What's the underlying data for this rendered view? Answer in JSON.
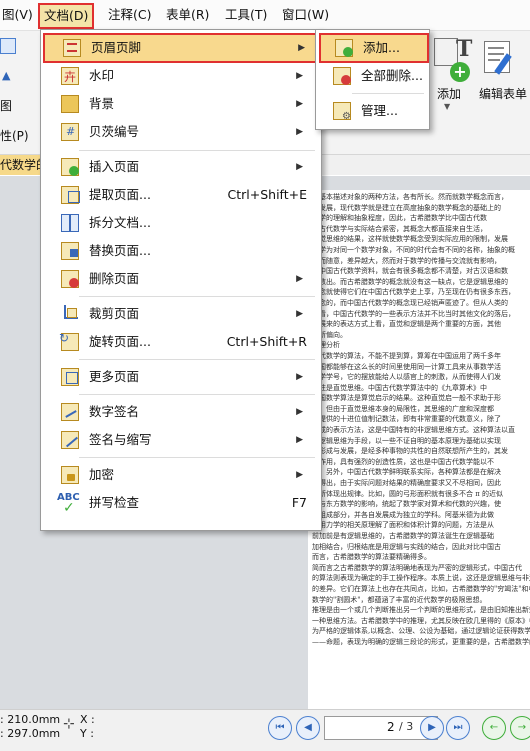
{
  "menubar": {
    "items": [
      {
        "label": "图(V)"
      },
      {
        "label": "文档(D)"
      },
      {
        "label": "注释(C)"
      },
      {
        "label": "表单(R)"
      },
      {
        "label": "工具(T)"
      },
      {
        "label": "窗口(W)"
      }
    ]
  },
  "toolbar": {
    "left_labels": [
      "图",
      "性(P)"
    ],
    "add_label": "添加",
    "edit_form_label": "编辑表单"
  },
  "doc_tab": {
    "label": "代数学的"
  },
  "document_menu": {
    "items": [
      {
        "label": "页眉页脚",
        "shortcut": "",
        "icon": "header-footer-icon"
      },
      {
        "label": "水印",
        "shortcut": "",
        "icon": "watermark-icon"
      },
      {
        "label": "背景",
        "shortcut": "",
        "icon": "background-icon"
      },
      {
        "label": "贝茨编号",
        "shortcut": "",
        "icon": "bates-numbering-icon"
      },
      {
        "label": "插入页面",
        "shortcut": "",
        "icon": "insert-page-icon"
      },
      {
        "label": "提取页面...",
        "shortcut": "Ctrl+Shift+E",
        "icon": "extract-page-icon"
      },
      {
        "label": "拆分文档...",
        "shortcut": "",
        "icon": "split-document-icon"
      },
      {
        "label": "替换页面...",
        "shortcut": "",
        "icon": "replace-page-icon"
      },
      {
        "label": "删除页面",
        "shortcut": "",
        "icon": "delete-page-icon"
      },
      {
        "label": "裁剪页面",
        "shortcut": "",
        "icon": "crop-page-icon"
      },
      {
        "label": "旋转页面...",
        "shortcut": "Ctrl+Shift+R",
        "icon": "rotate-page-icon"
      },
      {
        "label": "更多页面",
        "shortcut": "",
        "icon": "more-pages-icon"
      },
      {
        "label": "数字签名",
        "shortcut": "",
        "icon": "digital-signature-icon"
      },
      {
        "label": "签名与缩写",
        "shortcut": "",
        "icon": "sign-initials-icon"
      },
      {
        "label": "加密",
        "shortcut": "",
        "icon": "encrypt-icon"
      },
      {
        "label": "拼写检查",
        "shortcut": "F7",
        "icon": "spell-check-icon"
      }
    ],
    "spell_icon_text": "ABC"
  },
  "submenu": {
    "items": [
      {
        "label": "添加...",
        "icon": "add-header-footer-icon"
      },
      {
        "label": "全部删除...",
        "icon": "remove-all-header-footer-icon"
      },
      {
        "label": "管理...",
        "icon": "manage-header-footer-icon"
      }
    ]
  },
  "page_text": [
    "些基本描述对象的两种方法，各有所长。然而就数学概念而言，",
    "中发展，现代数学就是建立在高度抽象的数学概念的基础上的",
    "数学的理解和抽象程度，因此，古希腊数学比中国古代数",
    "国古代数学与实际结合紧密，其概念大都直接来自生活，",
    "直觉思维的结果，这样就使数学概念受到实际应用的限制，发展",
    "数学为对同一个数学对象，不同的时代会有不同的名称，抽象的概",
    "形而随意，差异越大，然而对于数学的传播与交流就有影响，",
    "于中国古代数学资料，就会有很多概念都不清楚，对古汉语和数",
    "其数出。而古希腊数学的概念就没有这一缺点，它是逻辑思维的",
    "概念就使得它们在中国古代数学史上享，乃至现在仍有很多东西，",
    "概念的，而中国古代数学的概念现已经销声匿迹了。但从人类的",
    "来看，中国古代数学的一些表示方法并不比当时其他文化的落后，",
    "好展来的表达方式上看，直觉和逻辑是两个重要的方面，其他",
    "的所偏向。",
    "推理分析",
    "古代数学的算法，不能不提到算，算筹在中国运用了两千多年",
    "中国都能够在这么长的时间里使用同一计算工具来从事数学活",
    "数学学号，它的摆放能给人以感官上的刺激，从而使得人们发",
    "注往是直觉思维。中国古代数学算法中的《九章算术》中",
    "中国数学算法是算觉启示的结果。这种直觉启一般不求助于形",
    "推，但由于直觉思维本身的局限性，其思维的广度和深度都",
    "的提供的十进位值制记数法，即有非常重要的代数意义，除了",
    "完成的表示方法，这是中国特有的非逻辑思维方式。这种算法以直",
    "以逻辑思维为手段，以一些不证自明的基本原理为基础以实现",
    "的形成与发展，是经多种事物的共性的自然联想所产生的，其发",
    "的作用，具有强烈的创造性质，这也是中国古代数学能以不",
    "一，另外，中国古代数学鲜明联系实际，各种算法都是在解决",
    "结得出，由于实际问题对结果的精确度要求又不尽相同，因此",
    "都所体现出规律。比如，圆的弓形面积就有很多不合 π 的近似",
    "所与东方数学的影响，统起了数学家对算术和代数的兴趣，使",
    "的组成部分，并各自发展成为独立的学科。阿基米德为此做",
    "应用力学的相关原理解了面积和体积计算的问题，方法是从",
    "前加前是有逻辑思维的，古希腊数学的算法诞生在逻辑基础",
    "加相结合，归根结底是用逻辑与实践的结合，因此对比中国古",
    "而言，古希腊数学的算法要精确得多。",
    "简而言之古希腊数学的算法明确地表现为严密的逻辑形式，中国古代",
    "的算法则表现为确定的手工操作程序。本质上说，这还是逻辑思维与非逻辑",
    "的差异。它们在算法上也存在共同点，比如，古希腊数学的\"穷竭法\"和中国",
    "数学的\"割圆术\"，都蕴涵了丰富的近代数学的极限思想。",
    "推理是由一个或几个判断推出另一个判断的思维形式，是由旧知推出新知",
    "一种思维方法。古希腊数学中的推理，尤其反映在欧几里得的《原本》中，",
    "为严格的逻辑体系,以概念、公理、公设为基础，通过逻辑论证获得数学结论",
    "——命题，表现为明确的逻辑三段论的形式，更重要的是，古希腊数学的推理"
  ],
  "status": {
    "width_text": "210.0mm",
    "height_text": "297.0mm",
    "x_label": "X :",
    "y_label": "Y :",
    "current_page": "2",
    "total_pages": "/ 3",
    "total_pages_num": "3"
  }
}
